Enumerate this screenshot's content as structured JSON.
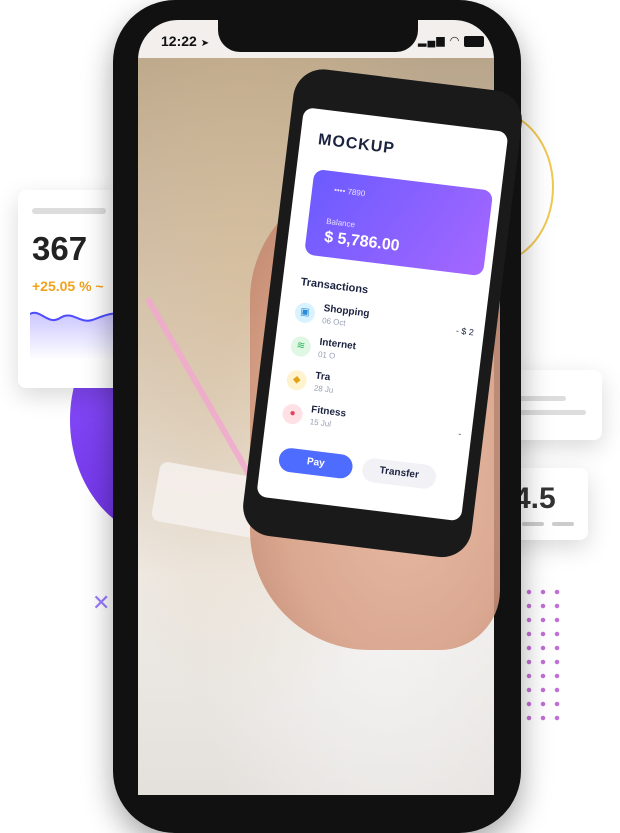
{
  "colors": {
    "accent_purple": "#8c52ff",
    "accent_gold": "#f2a11a",
    "pay_blue": "#4e6cff",
    "card_gradient_start": "#6b5bff",
    "card_gradient_end": "#a567ff"
  },
  "status_bar": {
    "time": "12:22",
    "icons": [
      "location-arrow-icon",
      "signal-icon",
      "wifi-icon",
      "battery-icon"
    ]
  },
  "stat_card": {
    "value": "367",
    "change": "+25.05 %"
  },
  "rating_card": {
    "value": "4.5"
  },
  "app": {
    "title": "MOCKUP",
    "card": {
      "number": "•••• 7890",
      "balance_label": "Balance",
      "balance": "$ 5,786.00"
    },
    "transactions_title": "Transactions",
    "transactions": [
      {
        "name": "Shopping",
        "date": "06 Oct",
        "amount": "- $ 2",
        "icon": "shopping-basket-icon"
      },
      {
        "name": "Internet",
        "date": "01 O",
        "amount": "",
        "icon": "wifi-icon"
      },
      {
        "name": "Tra",
        "date": "28 Ju",
        "amount": "",
        "icon": "car-icon"
      },
      {
        "name": "Fitness",
        "date": "15 Jul",
        "amount": "-",
        "icon": "fitness-icon"
      }
    ],
    "pay_label": "Pay",
    "transfer_label": "Transfer"
  }
}
